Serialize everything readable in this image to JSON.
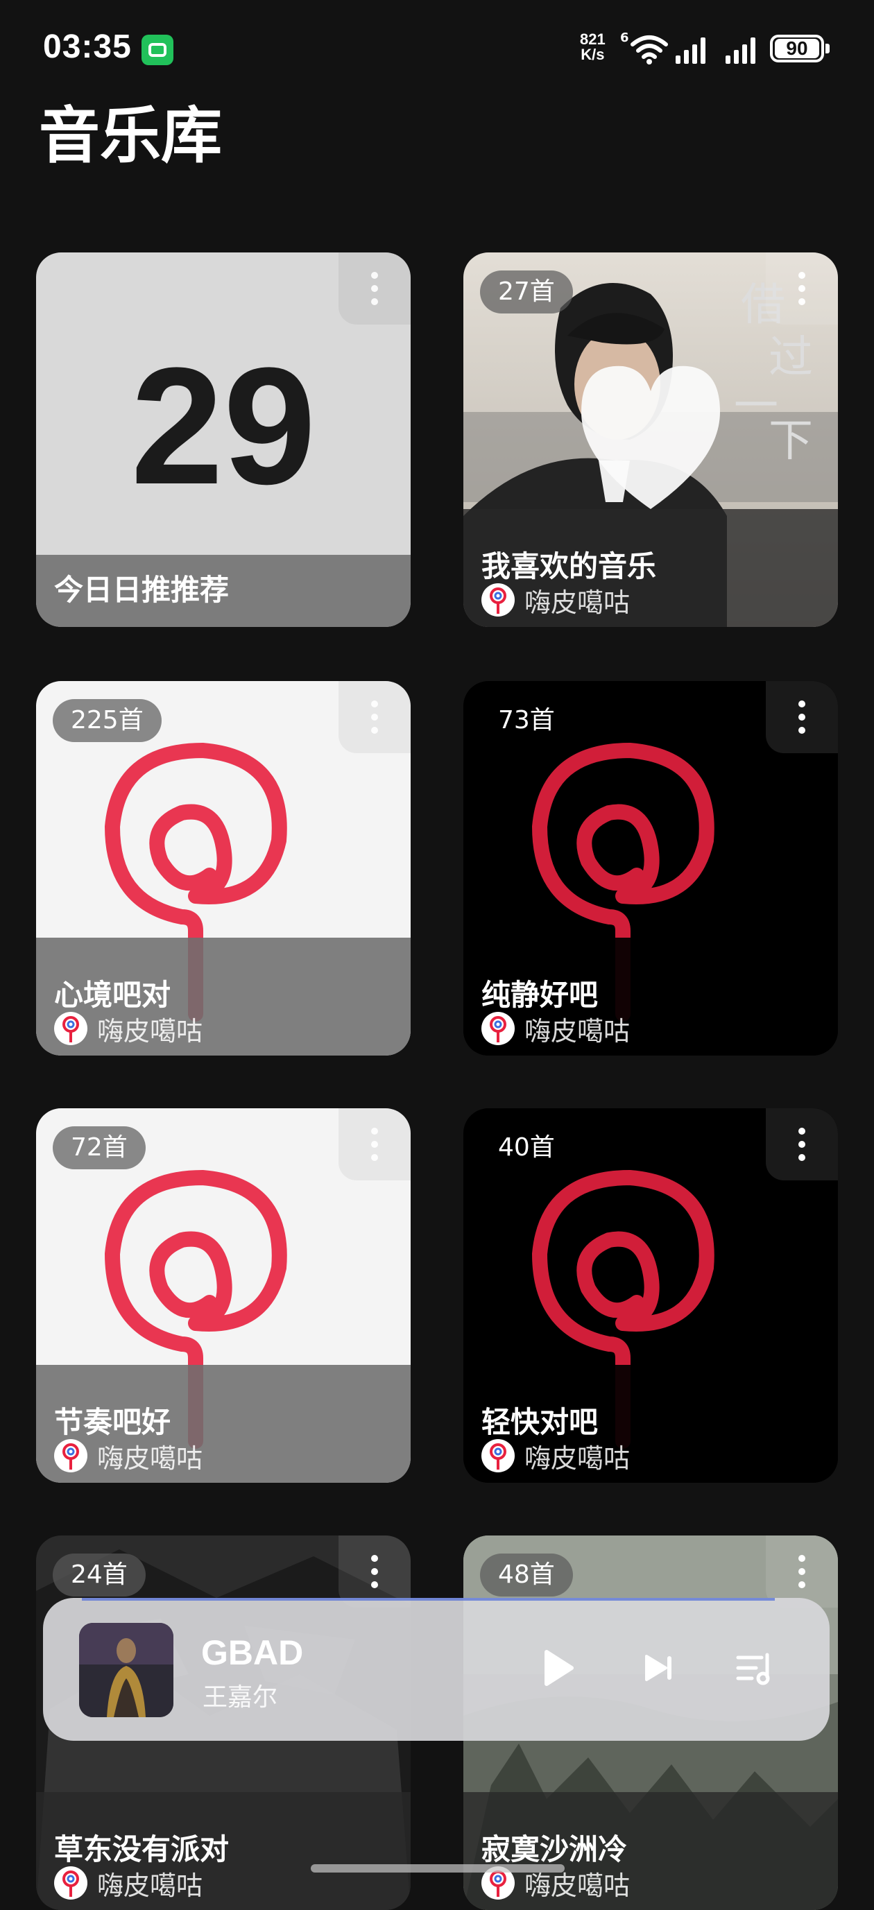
{
  "status_bar": {
    "time": "03:35",
    "net_speed_value": "821",
    "net_speed_unit": "K/s",
    "wifi_generation": "6",
    "battery": "90"
  },
  "page": {
    "title": "音乐库"
  },
  "playlists": [
    {
      "name": "今日日推推荐",
      "day": "29"
    },
    {
      "name": "我喜欢的音乐",
      "count": "27首",
      "owner": "嗨皮噶咕"
    },
    {
      "name": "心境吧对",
      "count": "225首",
      "owner": "嗨皮噶咕"
    },
    {
      "name": "纯静好吧",
      "count": "73首",
      "owner": "嗨皮噶咕"
    },
    {
      "name": "节奏吧好",
      "count": "72首",
      "owner": "嗨皮噶咕"
    },
    {
      "name": "轻快对吧",
      "count": "40首",
      "owner": "嗨皮噶咕"
    },
    {
      "name": "草东没有派对",
      "count": "24首",
      "owner": "嗨皮噶咕"
    },
    {
      "name": "寂寞沙洲冷",
      "count": "48首",
      "owner": "嗨皮噶咕"
    }
  ],
  "cover_text": [
    "借",
    "过",
    "一",
    "下"
  ],
  "player": {
    "track": "GBAD",
    "artist": "王嘉尔",
    "progress": 0.95
  },
  "colors": {
    "background": "#121212",
    "lollipop": "#e8213f",
    "chat_badge": "#21c15a"
  },
  "icons": [
    "chat-icon",
    "wifi-icon",
    "signal-icon",
    "battery-icon",
    "more-icon",
    "heart-icon",
    "play-icon",
    "next-icon",
    "playlist-icon"
  ]
}
